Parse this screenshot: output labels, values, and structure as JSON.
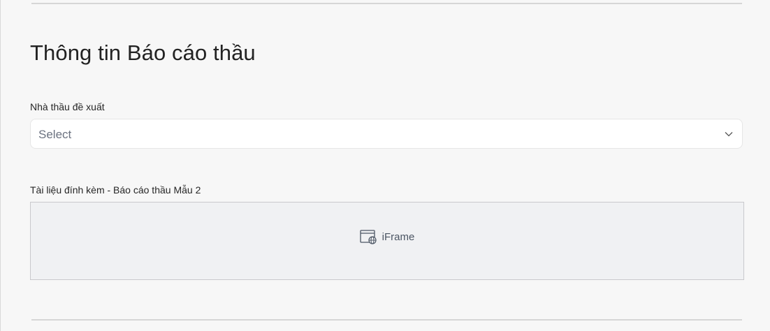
{
  "section": {
    "title": "Thông tin Báo cáo thầu"
  },
  "contractor_field": {
    "label": "Nhà thầu đề xuất",
    "placeholder": "Select"
  },
  "attachment_field": {
    "label": "Tài liệu đính kèm - Báo cáo thầu Mẫu 2",
    "embed_label": "iFrame",
    "embed_icon": "iframe-globe-icon"
  },
  "colors": {
    "background": "#f7f7f7",
    "input_background": "#ffffff",
    "embed_background": "#f0f1f3",
    "placeholder_text": "#6b7280"
  }
}
